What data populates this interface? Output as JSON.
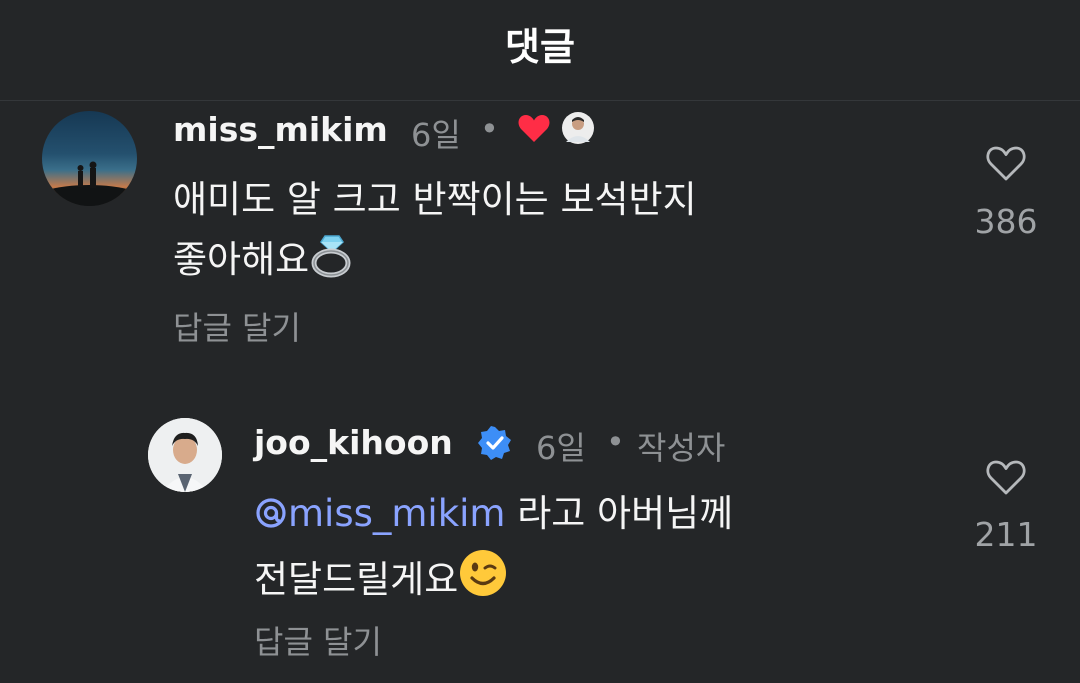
{
  "header": {
    "title": "댓글"
  },
  "comments": [
    {
      "username": "miss_mikim",
      "age": "6일",
      "separator": "•",
      "text_line1": "애미도 알 크고 반짝이는 보석반지",
      "text_line2": "좋아해요",
      "emoji": "ring-emoji",
      "reply_label": "답글 달기",
      "like_count": "386",
      "liked_by_author": true
    },
    {
      "username": "joo_kihoon",
      "verified": true,
      "age": "6일",
      "separator": "•",
      "author_label": "작성자",
      "mention": "miss_mikim",
      "text_after_mention": "라고 아버님께",
      "text_line2": "전달드릴게요",
      "emoji": "winking-face-emoji",
      "reply_label": "답글 달기",
      "like_count": "211"
    }
  ],
  "colors": {
    "background": "#242628",
    "text": "#f5f5f5",
    "muted": "#8e9194",
    "mention": "#8aa3ff",
    "heart": "#ff2d46",
    "verified": "#3d8ef7"
  }
}
